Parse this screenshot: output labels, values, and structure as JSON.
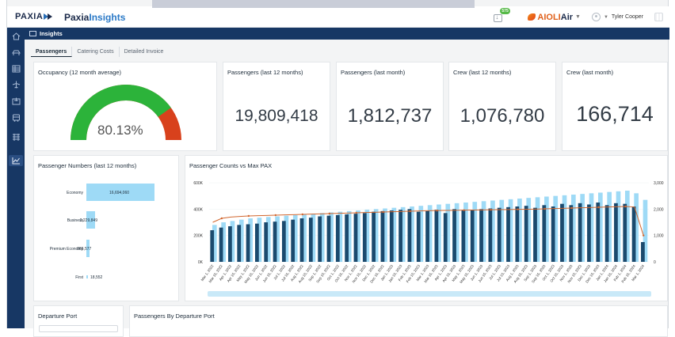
{
  "brand": {
    "name": "PAXIA",
    "app_title_prefix": "Paxia",
    "app_title_suffix": "Insights"
  },
  "topbar": {
    "download_badge": "575",
    "airline_prefix": "AIOLI",
    "airline_suffix": "Air",
    "user_name": "Tyler Cooper"
  },
  "sidebar": {
    "icons": [
      "home-icon",
      "plane-side-icon",
      "list-icon",
      "plane-icon",
      "plane-box-icon",
      "bus-icon",
      "report-icon",
      "insights-chart-icon"
    ]
  },
  "header": {
    "title": "Insights"
  },
  "tabs": [
    {
      "label": "Passengers",
      "active": true
    },
    {
      "label": "Catering Costs",
      "active": false
    },
    {
      "label": "Detailed Invoice",
      "active": false
    }
  ],
  "kpis": {
    "occupancy": {
      "title": "Occupancy (12 month average)",
      "value": "80.13%",
      "fraction": 0.8013
    },
    "pax_12m": {
      "title": "Passengers (last 12 months)",
      "value": "19,809,418"
    },
    "pax_last_month": {
      "title": "Passengers (last month)",
      "value": "1,812,737"
    },
    "crew_12m": {
      "title": "Crew (last 12 months)",
      "value": "1,076,780"
    },
    "crew_last_month": {
      "title": "Crew (last month)",
      "value": "166,714"
    }
  },
  "colors": {
    "gauge_green": "#2cb33a",
    "gauge_red": "#d8411c",
    "bar_light": "#9edaf6",
    "bar_dark": "#1b4a6e",
    "line": "#d2672f",
    "nav": "#173764"
  },
  "panels": {
    "passenger_numbers": {
      "title": "Passenger Numbers (last 12 months)"
    },
    "counts_vs_max": {
      "title": "Passenger Counts vs Max PAX"
    },
    "departure_port": {
      "title": "Departure Port"
    },
    "pax_by_port": {
      "title": "Passengers By Departure Port"
    }
  },
  "chart_data": [
    {
      "type": "bar",
      "orientation": "horizontal",
      "categories": [
        "Economy",
        "Business",
        "Premium Economy",
        "First"
      ],
      "values": [
        16694060,
        2229849,
        866577,
        18552
      ],
      "labels": [
        "16,694,060",
        "2,229,849",
        "866,577",
        "18,552"
      ]
    },
    {
      "type": "bar",
      "title": "Passenger Counts vs Max PAX",
      "y_ticks_left": [
        "600K",
        "400K",
        "200K",
        "0K"
      ],
      "ylim_left": [
        0,
        600000
      ],
      "y_ticks_right": [
        "3,000",
        "2,000",
        "1,000",
        "0"
      ],
      "ylim_right": [
        0,
        3000
      ],
      "categories": [
        "Mar 1, 2022",
        "Mar 15, 2022",
        "Apr 1, 2022",
        "Apr 15, 2022",
        "May 1, 2022",
        "May 15, 2022",
        "Jun 1, 2022",
        "Jun 15, 2022",
        "Jul 1, 2022",
        "Jul 15, 2022",
        "Aug 1, 2022",
        "Aug 15, 2022",
        "Sep 1, 2022",
        "Sep 15, 2022",
        "Oct 1, 2022",
        "Oct 15, 2022",
        "Nov 1, 2022",
        "Nov 15, 2022",
        "Dec 1, 2022",
        "Dec 15, 2022",
        "Jan 1, 2023",
        "Jan 15, 2023",
        "Feb 1, 2023",
        "Feb 15, 2023",
        "Mar 1, 2023",
        "Mar 15, 2023",
        "Apr 1, 2023",
        "Apr 15, 2023",
        "May 1, 2023",
        "May 15, 2023",
        "Jun 1, 2023",
        "Jun 15, 2023",
        "Jul 1, 2023",
        "Jul 15, 2023",
        "Aug 1, 2023",
        "Aug 15, 2023",
        "Sep 1, 2023",
        "Sep 15, 2023",
        "Oct 1, 2023",
        "Oct 15, 2023",
        "Nov 1, 2023",
        "Nov 15, 2023",
        "Dec 1, 2023",
        "Dec 15, 2023",
        "Jan 1, 2024",
        "Jan 15, 2024",
        "Feb 1, 2024",
        "Feb 15, 2024",
        "Mar 1, 2024"
      ],
      "tick_labels_shown": [
        "Mar 1, 2022",
        "Mar 15, 2022",
        "Apr 1, 2022",
        "Apr 15, 2022",
        "May 1, 2022",
        "May 15, 2022",
        "Jun 1, 2022",
        "Jun 15, 2022",
        "Jul 1, 2022",
        "Jul 15, 2022",
        "Aug 1, 2022",
        "Aug 15, 2022",
        "Sep 1, 2022",
        "Sep 15, 2022",
        "Oct 1, 2022",
        "Oct 15, 2022",
        "Nov 1, 2022",
        "Nov 15, 2022",
        "Dec 1, 2022",
        "Dec 15, 2022",
        "Jan 1, 2023",
        "Jan 15, 2023",
        "Feb 1, 2023",
        "Feb 15, 2023",
        "Mar 1, 2023",
        "Mar 15, 2023",
        "Apr 1, 2023",
        "Apr 15, 2023",
        "May 1, 2023",
        "May 15, 2023",
        "Jun 1, 2023",
        "Jun 15, 2023",
        "Jul 1, 2023",
        "Jul 15, 2023",
        "Aug 1, 2023",
        "Aug 15, 2023",
        "Sep 1, 2023",
        "Sep 15, 2023",
        "Oct 1, 2023",
        "Oct 15, 2023",
        "Nov 1, 2023",
        "Nov 15, 2023",
        "Dec 1, 2023",
        "Dec 15, 2023",
        "Jan 1, 2024",
        "Jan 15, 2024",
        "Feb 1, 2024",
        "Feb 15, 2024",
        "Mar 1, 2024"
      ],
      "series": [
        {
          "axis": "left",
          "style": "light-bar",
          "values": [
            280000,
            300000,
            310000,
            320000,
            330000,
            335000,
            340000,
            345000,
            350000,
            355000,
            360000,
            365000,
            370000,
            375000,
            380000,
            385000,
            390000,
            395000,
            400000,
            405000,
            410000,
            415000,
            420000,
            425000,
            430000,
            435000,
            440000,
            445000,
            450000,
            455000,
            460000,
            465000,
            470000,
            475000,
            480000,
            485000,
            490000,
            495000,
            500000,
            505000,
            510000,
            515000,
            520000,
            525000,
            530000,
            535000,
            540000,
            520000,
            470000
          ]
        },
        {
          "axis": "left",
          "style": "dark-bar",
          "values": [
            240000,
            260000,
            270000,
            280000,
            285000,
            290000,
            300000,
            305000,
            310000,
            320000,
            330000,
            335000,
            345000,
            350000,
            355000,
            360000,
            365000,
            370000,
            380000,
            385000,
            390000,
            395000,
            400000,
            380000,
            390000,
            395000,
            370000,
            400000,
            390000,
            395000,
            400000,
            405000,
            410000,
            415000,
            420000,
            425000,
            410000,
            430000,
            420000,
            440000,
            430000,
            445000,
            435000,
            450000,
            430000,
            445000,
            440000,
            420000,
            150000
          ]
        },
        {
          "axis": "right",
          "style": "line",
          "values": [
            1500,
            1650,
            1700,
            1720,
            1740,
            1750,
            1760,
            1770,
            1780,
            1790,
            1800,
            1810,
            1820,
            1830,
            1840,
            1850,
            1860,
            1870,
            1880,
            1890,
            1900,
            1910,
            1920,
            1930,
            1940,
            1945,
            1950,
            1955,
            1960,
            1965,
            1970,
            1975,
            1980,
            1985,
            1990,
            1995,
            2000,
            2010,
            2020,
            2030,
            2040,
            2050,
            2060,
            2070,
            2080,
            2090,
            2100,
            2080,
            1000
          ]
        }
      ]
    }
  ]
}
